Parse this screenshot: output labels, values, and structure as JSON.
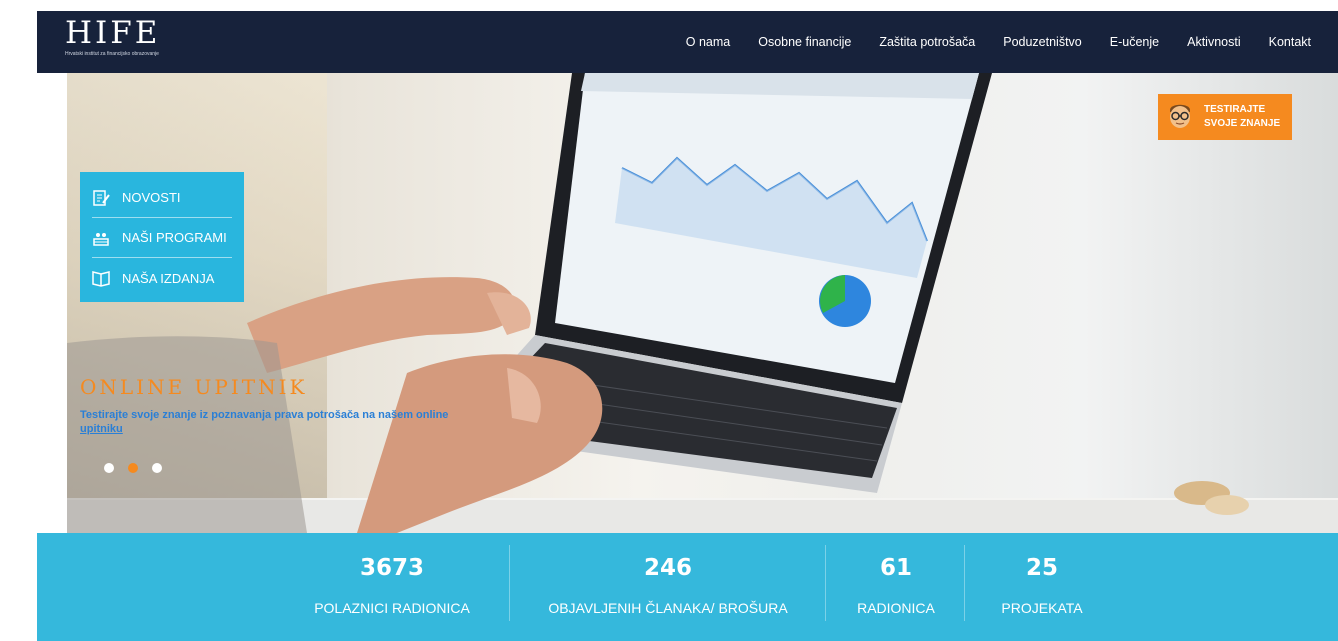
{
  "brand": {
    "logo": "HIFE",
    "tagline": "Hrvatski institut za financijsko obrazovanje"
  },
  "nav": {
    "items": [
      {
        "label": "O nama"
      },
      {
        "label": "Osobne financije"
      },
      {
        "label": "Zaštita potrošača"
      },
      {
        "label": "Poduzetništvo"
      },
      {
        "label": "E-učenje"
      },
      {
        "label": "Aktivnosti"
      },
      {
        "label": "Kontakt"
      }
    ]
  },
  "side_menu": {
    "items": [
      {
        "label": "NOVOSTI",
        "icon": "news-icon"
      },
      {
        "label": "NAŠI PROGRAMI",
        "icon": "programs-icon"
      },
      {
        "label": "NAŠA IZDANJA",
        "icon": "book-icon"
      }
    ]
  },
  "quiz_button": {
    "line1": "TESTIRAJTE",
    "line2": "SVOJE ZNANJE",
    "icon": "avatar-glasses-icon"
  },
  "slide": {
    "title": "ONLINE UPITNIK",
    "description": "Testirajte svoje znanje iz poznavanja prava potrošača na našem online",
    "link_text": "upitniku"
  },
  "carousel": {
    "slide_count": 3,
    "active_index": 1
  },
  "stats": [
    {
      "value": "3673",
      "caption": "POLAZNICI RADIONICA"
    },
    {
      "value": "246",
      "caption": "OBJAVLJENIH ČLANAKA/ BROŠURA"
    },
    {
      "value": "61",
      "caption": "RADIONICA"
    },
    {
      "value": "25",
      "caption": "PROJEKATA"
    }
  ],
  "colors": {
    "nav_bg": "#17223b",
    "accent_blue": "#35b8dc",
    "accent_orange": "#f58a1f",
    "menu_blue": "#29b6de"
  }
}
